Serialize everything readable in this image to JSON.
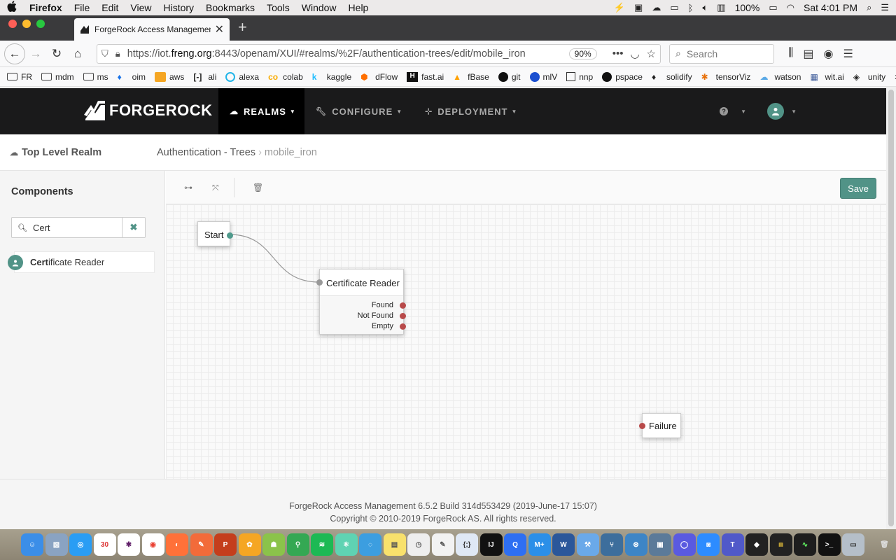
{
  "menubar": {
    "app": "Firefox",
    "items": [
      "File",
      "Edit",
      "View",
      "History",
      "Bookmarks",
      "Tools",
      "Window",
      "Help"
    ],
    "battery": "100%",
    "clock": "Sat 4:01 PM"
  },
  "browser": {
    "tab_title": "ForgeRock Access Management",
    "url_prefix": "https://iot.",
    "url_host": "freng.org",
    "url_rest": ":8443/openam/XUI/#realms/%2F/authentication-trees/edit/mobile_iron",
    "zoom": "90%",
    "search_placeholder": "Search"
  },
  "bookmarks": [
    "FR",
    "mdm",
    "ms",
    "oim",
    "aws",
    "ali",
    "alexa",
    "colab",
    "kaggle",
    "dFlow",
    "fast.ai",
    "fBase",
    "git",
    "mlV",
    "nnp",
    "pspace",
    "solidify",
    "tensorViz",
    "watson",
    "wit.ai",
    "unity"
  ],
  "header": {
    "logo": "FORGEROCK",
    "nav": [
      {
        "label": "REALMS",
        "icon": "cloud-icon"
      },
      {
        "label": "CONFIGURE",
        "icon": "wrench-icon"
      },
      {
        "label": "DEPLOYMENT",
        "icon": "sitemap-icon"
      }
    ]
  },
  "breadcrumb": {
    "realm": "Top Level Realm",
    "section": "Authentication - Trees",
    "current": "mobile_iron"
  },
  "sidebar": {
    "title": "Components",
    "filter_value": "Cert",
    "component_match": "Cert",
    "component_rest": "ificate Reader"
  },
  "toolbar": {
    "save_label": "Save"
  },
  "canvas": {
    "start_node": "Start",
    "cert_node": {
      "title": "Certificate Reader",
      "outcomes": [
        "Found",
        "Not Found",
        "Empty"
      ]
    },
    "failure_node": "Failure"
  },
  "footer": {
    "line1": "ForgeRock Access Management 6.5.2 Build 314d553429 (2019-June-17 15:07)",
    "line2": "Copyright © 2010-2019 ForgeRock AS. All rights reserved."
  },
  "dock": {
    "calendar_day": "30",
    "badges": [
      "W",
      "M+",
      "T",
      "IJ"
    ]
  },
  "colors": {
    "accent": "#519387",
    "header_bg": "#1a1a1b",
    "failure_port": "#b84a4a"
  }
}
